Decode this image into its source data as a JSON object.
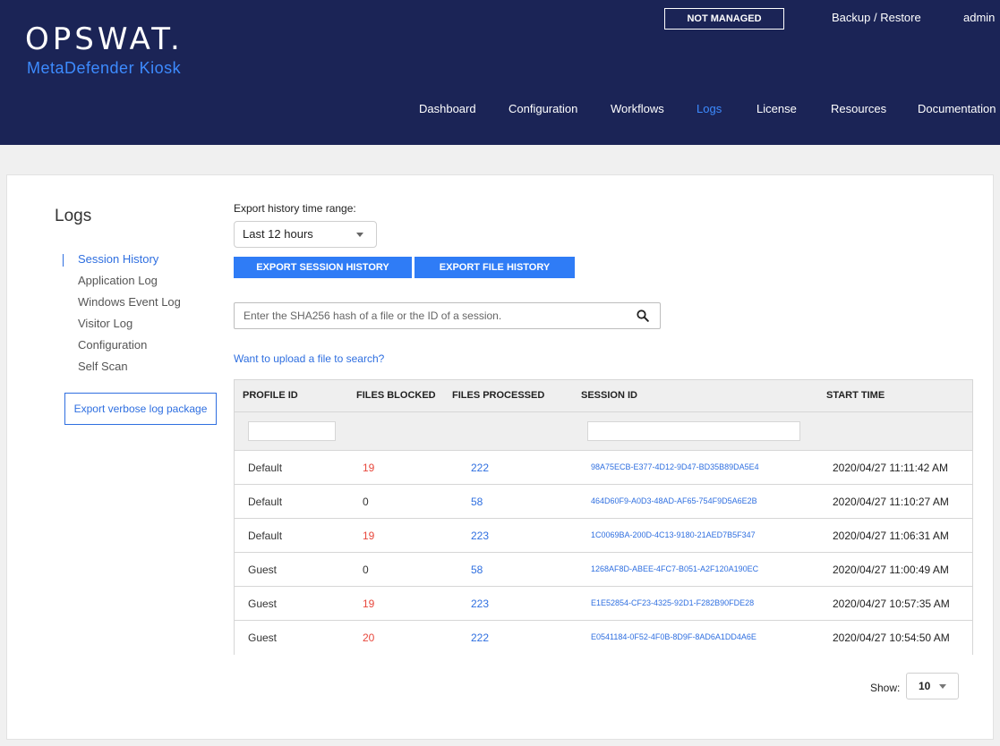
{
  "header": {
    "logo": "OPSWAT.",
    "product": "MetaDefender Kiosk",
    "status": "NOT MANAGED",
    "backup": "Backup / Restore",
    "user": "admin",
    "nav": [
      {
        "label": "Dashboard"
      },
      {
        "label": "Configuration"
      },
      {
        "label": "Workflows"
      },
      {
        "label": "Logs",
        "active": true
      },
      {
        "label": "License"
      },
      {
        "label": "Resources"
      },
      {
        "label": "Documentation"
      }
    ]
  },
  "sidebar": {
    "title": "Logs",
    "items": [
      {
        "label": "Session History",
        "active": true
      },
      {
        "label": "Application Log"
      },
      {
        "label": "Windows Event Log"
      },
      {
        "label": "Visitor Log"
      },
      {
        "label": "Configuration"
      },
      {
        "label": "Self Scan"
      }
    ],
    "verbose_button": "Export verbose log package"
  },
  "export": {
    "label": "Export history time range:",
    "range": "Last 12 hours",
    "session_button": "EXPORT SESSION HISTORY",
    "file_button": "EXPORT FILE HISTORY"
  },
  "search": {
    "placeholder": "Enter the SHA256 hash of a file or the ID of a session.",
    "upload_link": "Want to upload a file to search?"
  },
  "table": {
    "columns": [
      "PROFILE ID",
      "FILES BLOCKED",
      "FILES PROCESSED",
      "SESSION ID",
      "START TIME"
    ],
    "rows": [
      {
        "profile": "Default",
        "blocked": "19",
        "processed": "222",
        "session": "98A75ECB-E377-4D12-9D47-BD35B89DA5E4",
        "start": "2020/04/27 11:11:42 AM"
      },
      {
        "profile": "Default",
        "blocked": "0",
        "processed": "58",
        "session": "464D60F9-A0D3-48AD-AF65-754F9D5A6E2B",
        "start": "2020/04/27 11:10:27 AM"
      },
      {
        "profile": "Default",
        "blocked": "19",
        "processed": "223",
        "session": "1C0069BA-200D-4C13-9180-21AED7B5F347",
        "start": "2020/04/27 11:06:31 AM"
      },
      {
        "profile": "Guest",
        "blocked": "0",
        "processed": "58",
        "session": "1268AF8D-ABEE-4FC7-B051-A2F120A190EC",
        "start": "2020/04/27 11:00:49 AM"
      },
      {
        "profile": "Guest",
        "blocked": "19",
        "processed": "223",
        "session": "E1E52854-CF23-4325-92D1-F282B90FDE28",
        "start": "2020/04/27 10:57:35 AM"
      },
      {
        "profile": "Guest",
        "blocked": "20",
        "processed": "222",
        "session": "E0541184-0F52-4F0B-8D9F-8AD6A1DD4A6E",
        "start": "2020/04/27 10:54:50 AM"
      }
    ]
  },
  "pagination": {
    "show_label": "Show:",
    "page_size": "10"
  },
  "colors": {
    "header_bg": "#1b2456",
    "accent": "#2f7cf6",
    "blocked_red": "#e8483d"
  }
}
